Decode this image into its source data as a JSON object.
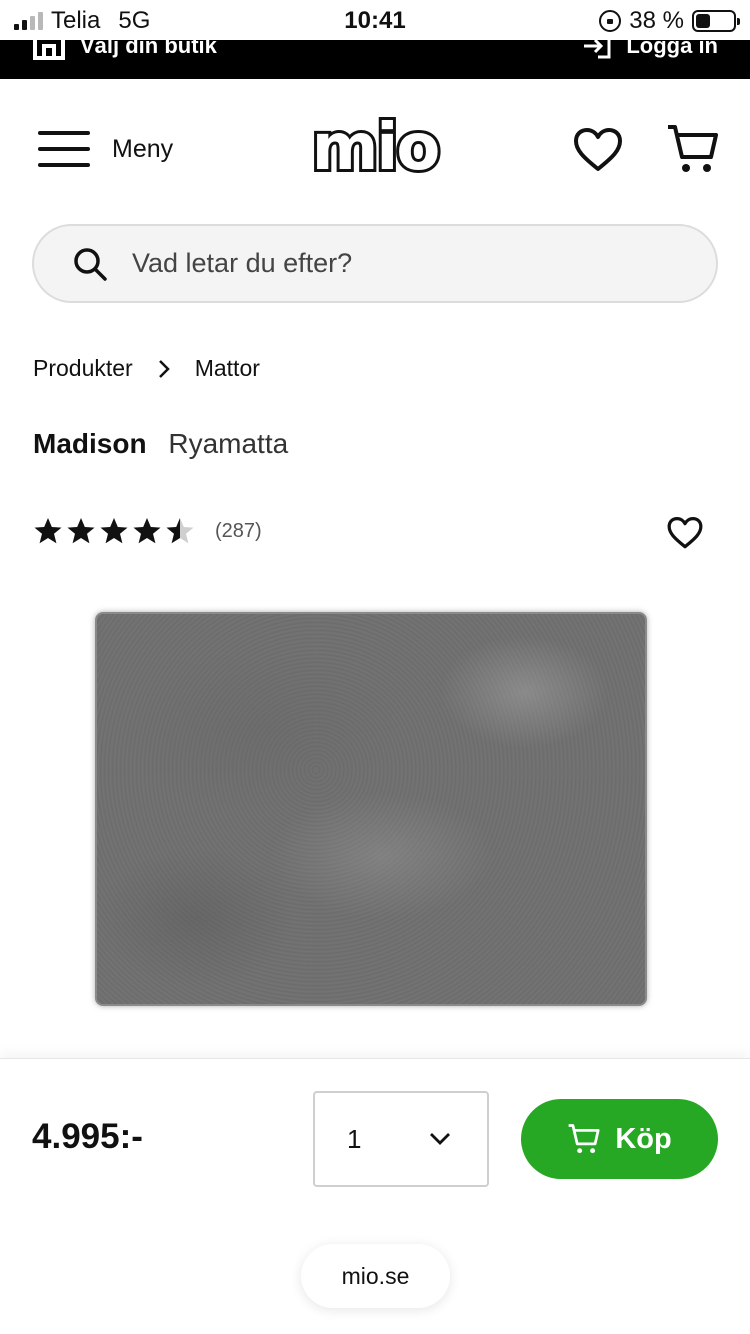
{
  "status_bar": {
    "carrier": "Telia",
    "network": "5G",
    "time": "10:41",
    "battery_text": "38 %",
    "battery_level": 0.38
  },
  "top_strip": {
    "store_label": "Välj din butik",
    "login_label": "Logga in"
  },
  "header": {
    "menu_label": "Meny",
    "logo_text": "mio"
  },
  "search": {
    "placeholder": "Vad letar du efter?"
  },
  "breadcrumb": [
    "Produkter",
    "Mattor"
  ],
  "product": {
    "brand": "Madison",
    "type": "Ryamatta",
    "rating": 4.5,
    "rating_max": 5,
    "review_count": "(287)",
    "price": "4.995:-"
  },
  "buy_bar": {
    "quantity": "1",
    "buy_label": "Köp"
  },
  "browser": {
    "url": "mio.se"
  },
  "colors": {
    "buy_button": "#26a825",
    "top_strip": "#000000",
    "search_bg": "#f4f4f4"
  }
}
